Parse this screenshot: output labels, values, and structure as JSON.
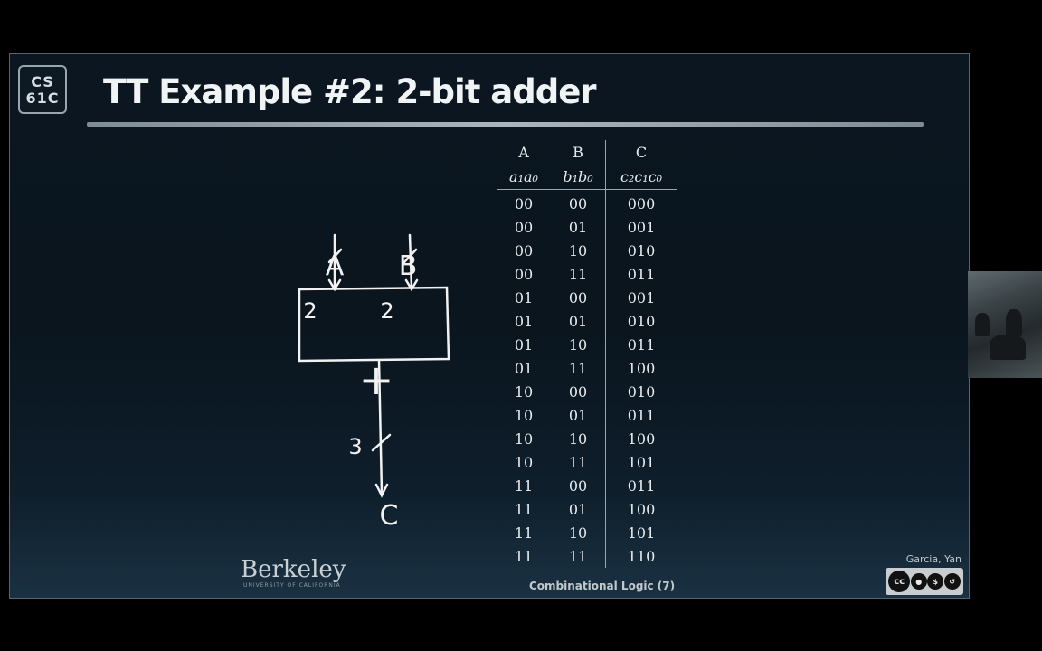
{
  "logo": {
    "line1": "CS",
    "line2": "61C"
  },
  "slide": {
    "title": "TT Example #2: 2-bit adder",
    "footer": "Combinational Logic (7)",
    "author": "Garcia, Yan",
    "institution": {
      "name": "Berkeley",
      "subtitle": "UNIVERSITY OF CALIFORNIA"
    },
    "license_icons": [
      "cc-icon",
      "by-icon",
      "nc-icon",
      "sa-icon"
    ]
  },
  "diagram": {
    "input_a": "A",
    "input_b": "B",
    "width_a": "2",
    "width_b": "2",
    "operator": "+",
    "width_out": "3",
    "output": "C"
  },
  "truth_table": {
    "headers": [
      "A",
      "B",
      "C"
    ],
    "subheaders": [
      "a₁a₀",
      "b₁b₀",
      "c₂c₁c₀"
    ],
    "rows": [
      [
        "00",
        "00",
        "000"
      ],
      [
        "00",
        "01",
        "001"
      ],
      [
        "00",
        "10",
        "010"
      ],
      [
        "00",
        "11",
        "011"
      ],
      [
        "01",
        "00",
        "001"
      ],
      [
        "01",
        "01",
        "010"
      ],
      [
        "01",
        "10",
        "011"
      ],
      [
        "01",
        "11",
        "100"
      ],
      [
        "10",
        "00",
        "010"
      ],
      [
        "10",
        "01",
        "011"
      ],
      [
        "10",
        "10",
        "100"
      ],
      [
        "10",
        "11",
        "101"
      ],
      [
        "11",
        "00",
        "011"
      ],
      [
        "11",
        "01",
        "100"
      ],
      [
        "11",
        "10",
        "101"
      ],
      [
        "11",
        "11",
        "110"
      ]
    ]
  }
}
